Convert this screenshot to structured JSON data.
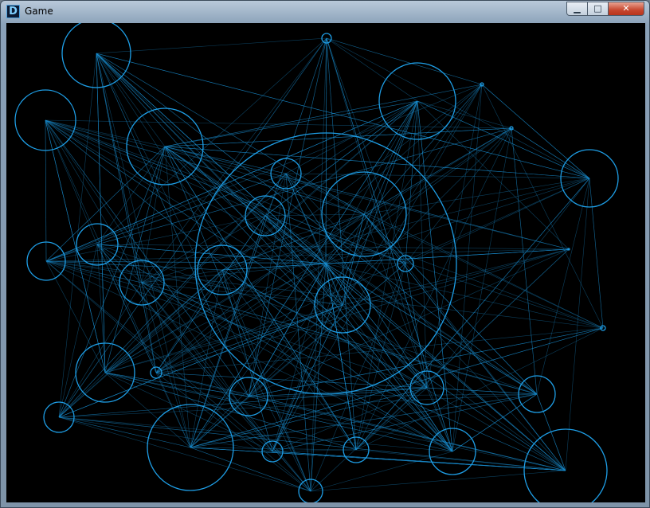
{
  "window": {
    "title": "Game",
    "app_icon_glyph": "D",
    "minimize_glyph": "▁",
    "maximize_glyph": "□",
    "close_glyph": "✕"
  },
  "colors": {
    "background": "#000000",
    "circle": "#1e9ee6",
    "link": "#1a8fd0"
  }
}
